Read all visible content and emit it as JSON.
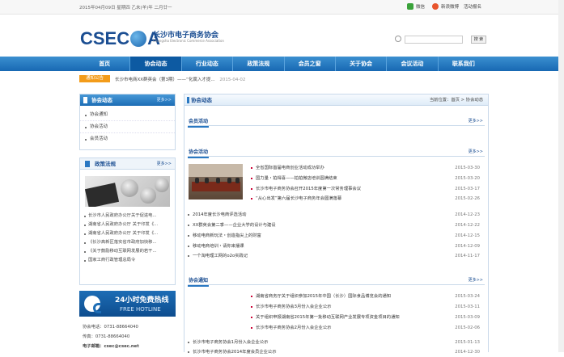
{
  "topbar": {
    "date": "2015年04月09日  星期四  乙未(羊)年  二月廿一",
    "wechat": "微信",
    "weibo": "新浪微博",
    "join": "活动报名"
  },
  "header": {
    "logo_text_a": "CSEC",
    "logo_text_b": "A",
    "logo_cn": "长沙市电子商务协会",
    "logo_en": "Changsha Electronic Commerce Association",
    "search_placeholder": "",
    "search_button": "搜 索"
  },
  "nav": {
    "items": [
      "首页",
      "协会动态",
      "行业动态",
      "政策法规",
      "会员之窗",
      "关于协会",
      "会议活动",
      "联系我们"
    ]
  },
  "notice": {
    "tag": "通知公告",
    "text": "长沙市电商XX群英会（第3期）——“化腐入才提...",
    "date": "2015-04-02"
  },
  "sidebar": {
    "title": "协会动态",
    "more": "更多>>",
    "items": [
      "协会通知",
      "协会活动",
      "会员活动"
    ],
    "policy": {
      "title": "政策法规",
      "more": "更多>>",
      "items": [
        "长沙市人民政府办公厅关于促进电...",
        "湖南省人民政府办公厅 关于印发《...",
        "湖南省人民政府办公厅 关于印发《...",
        "《长沙高新区落实省市政府加快移...",
        "《关于鼓励移动互联网发展的若干...",
        "国家工商行政管理总局令"
      ]
    },
    "hotline": {
      "cn": "24小时免费热线",
      "en": "FREE HOTLINE"
    },
    "contact": {
      "phone": "协会电话：0731-88664040",
      "fax": "传真：0731-88664040",
      "email": "电子邮箱：csec@csec.net"
    }
  },
  "main": {
    "title": "协会动态",
    "crumb_prefix": "当前位置：",
    "crumb_home": "首页",
    "crumb_sep": " > ",
    "crumb_current": "协会动态",
    "more": "更多>>",
    "section1": {
      "title": "会员活动"
    },
    "section2": {
      "title": "协会活动",
      "top": [
        {
          "t": "全省国际首届电商创业活动成功举办",
          "d": "2015-03-30"
        },
        {
          "t": "国力量・拍得喜——拍拍微店培训圆满结束",
          "d": "2015-03-20"
        },
        {
          "t": "长沙市电子商务协会召开2015年度第一次常务理事会议",
          "d": "2015-03-17"
        },
        {
          "t": "“从心出发”第六届长沙电子商务年会圆满落幕",
          "d": "2015-02-26"
        }
      ],
      "list": [
        {
          "t": "2014年度长沙电商评选活动",
          "d": "2014-12-23"
        },
        {
          "t": "XX群英会第二季——企业大学的设计与建设",
          "d": "2014-12-22"
        },
        {
          "t": "移动电商新玩法・创造指尖上的财富",
          "d": "2014-12-15"
        },
        {
          "t": "移动电商培训・请你来播课",
          "d": "2014-12-09"
        },
        {
          "t": "一个淘电理工网的o2o实践记",
          "d": "2014-11-17"
        }
      ]
    },
    "section3": {
      "title": "协会通知",
      "top": [
        {
          "t": "湖南省商务厅关于组织参加2015年中国（长沙）国际食品博览会的通知",
          "d": "2015-03-24"
        },
        {
          "t": "长沙市电子商务协会3月份入会企业公示",
          "d": "2015-03-11"
        },
        {
          "t": "关于组织申报湖南省2015年第一批移动互联网产业发展专项资金项目的通知",
          "d": "2015-03-09"
        },
        {
          "t": "长沙市电子商务协会2月份入会企业公示",
          "d": "2015-02-06"
        }
      ],
      "list": [
        {
          "t": "长沙市电子商务协会1月份入会企业公示",
          "d": "2015-01-13"
        },
        {
          "t": "长沙市电子商务协会2014年度会员企业公示",
          "d": "2014-12-30"
        }
      ]
    }
  }
}
